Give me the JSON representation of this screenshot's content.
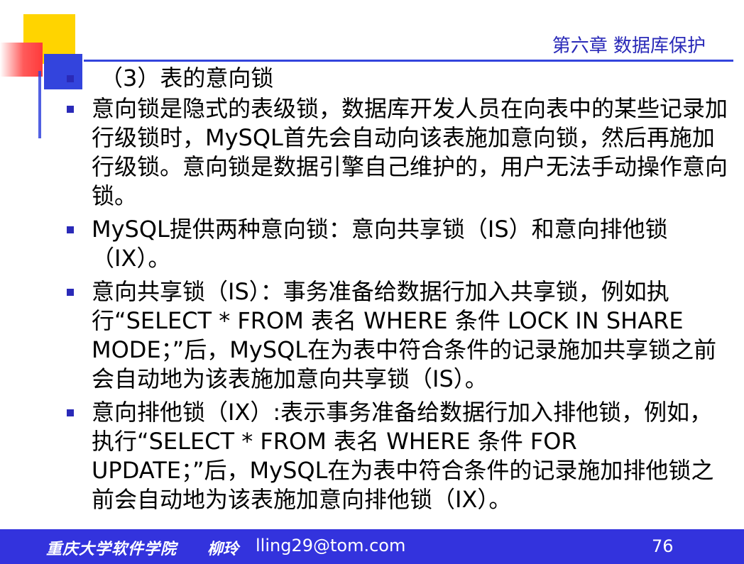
{
  "header": {
    "chapter_title": "第六章 数据库保护"
  },
  "slide": {
    "heading": "（3）表的意向锁",
    "items": [
      {
        "text": "意向锁是隐式的表级锁，数据库开发人员在向表中的某些记录加行级锁时，MySQL首先会自动向该表施加意向锁，然后再施加行级锁。意向锁是数据引擎自己维护的，用户无法手动操作意向锁。"
      },
      {
        "text": "MySQL提供两种意向锁：意向共享锁（IS）和意向排他锁（IX）。"
      },
      {
        "text": "意向共享锁（IS）：事务准备给数据行加入共享锁，例如执行“SELECT * FROM 表名 WHERE 条件 LOCK IN SHARE MODE；”后，MySQL在为表中符合条件的记录施加共享锁之前会自动地为该表施加意向共享锁（IS）。"
      },
      {
        "text": "意向排他锁（IX）:表示事务准备给数据行加入排他锁，例如，执行“SELECT * FROM 表名 WHERE 条件 FOR UPDATE；”后，MySQL在为表中符合条件的记录施加排他锁之前会自动地为该表施加意向排他锁（IX）。"
      }
    ]
  },
  "footer": {
    "school": "重庆大学软件学院",
    "author": "柳玲",
    "email": "lling29@tom.com",
    "page_number": "76"
  },
  "colors": {
    "accent_blue": "#3344dd",
    "title_blue": "#2a2ab8",
    "footer_blue": "#3333dd",
    "deco_yellow": "#ffd400",
    "deco_red": "#ff3a3a"
  }
}
